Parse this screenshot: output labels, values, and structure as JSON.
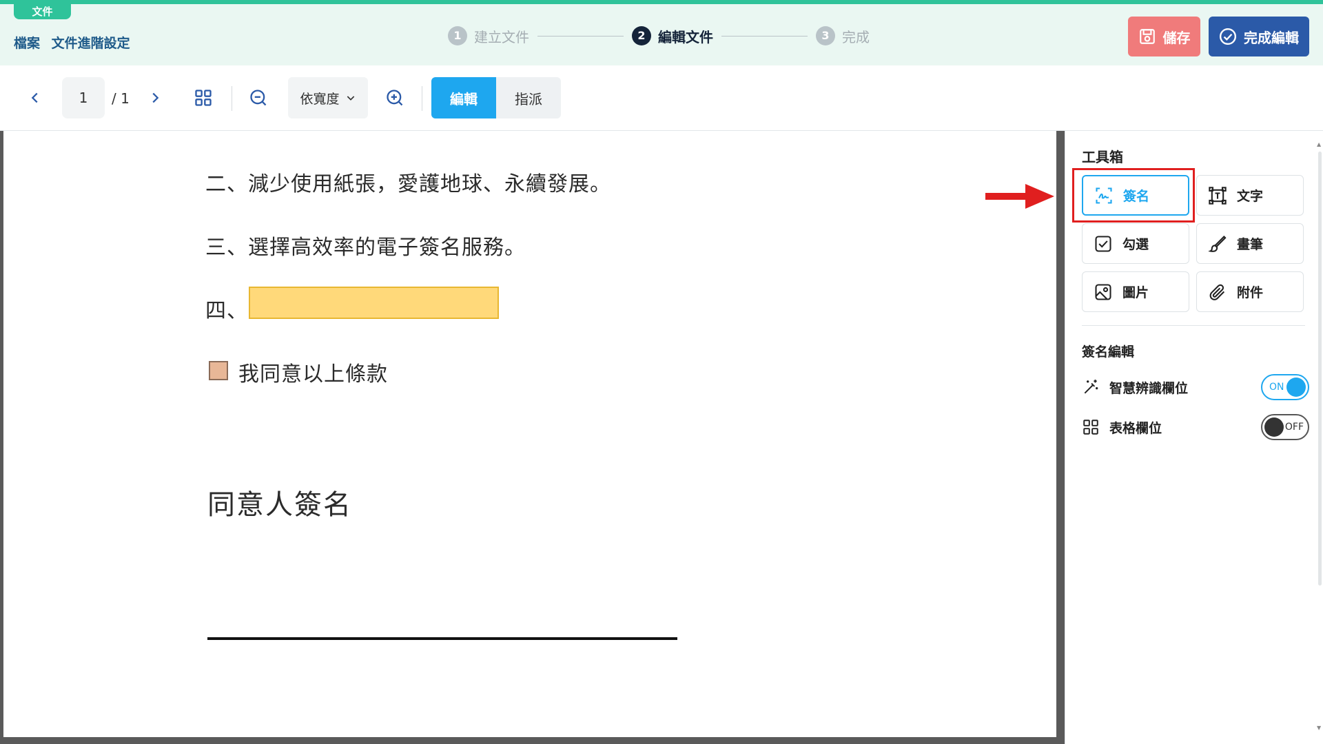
{
  "header": {
    "tag": "文件",
    "breadcrumb": [
      "檔案",
      "文件進階設定"
    ],
    "steps": [
      {
        "num": "1",
        "label": "建立文件"
      },
      {
        "num": "2",
        "label": "編輯文件"
      },
      {
        "num": "3",
        "label": "完成"
      }
    ],
    "active_step": 2,
    "save_label": "儲存",
    "done_label": "完成編輯"
  },
  "toolbar": {
    "page_current": "1",
    "page_total": "/ 1",
    "zoom_mode": "依寬度",
    "modes": [
      "編輯",
      "指派"
    ],
    "active_mode": "編輯"
  },
  "document": {
    "line2": "二、減少使用紙張，愛護地球、永續發展。",
    "line3": "三、選擇高效率的電子簽名服務。",
    "line4_prefix": "四、",
    "agree": "我同意以上條款",
    "sign_heading": "同意人簽名"
  },
  "panel": {
    "toolbox_title": "工具箱",
    "tools": [
      "簽名",
      "文字",
      "勾選",
      "畫筆",
      "圖片",
      "附件"
    ],
    "selected_tool": "簽名",
    "edit_title": "簽名編輯",
    "options": [
      {
        "label": "智慧辨識欄位",
        "state": "ON"
      },
      {
        "label": "表格欄位",
        "state": "OFF"
      }
    ]
  },
  "colors": {
    "brand_green": "#2fc39a",
    "accent_blue": "#1ea7ef",
    "save_red": "#f07b7b",
    "done_navy": "#2b5aa8",
    "field_yellow": "#ffd97a",
    "highlight_red": "#e01f1f"
  }
}
